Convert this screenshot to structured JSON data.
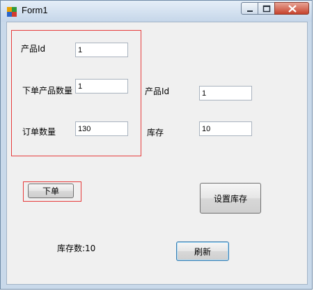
{
  "window": {
    "title": "Form1"
  },
  "order_group": {
    "product_id_label": "产品Id",
    "product_id_value": "1",
    "order_product_qty_label": "下单产品数量",
    "order_product_qty_value": "1",
    "order_qty_label": "订单数量",
    "order_qty_value": "130"
  },
  "stock_group": {
    "product_id_label": "产品Id",
    "product_id_value": "1",
    "stock_label": "库存",
    "stock_value": "10"
  },
  "buttons": {
    "place_order": "下单",
    "set_stock": "设置库存",
    "refresh": "刷新"
  },
  "status": {
    "stock_count_text": "库存数:10"
  },
  "colors": {
    "highlight_box": "#e63b3b",
    "client_bg": "#f0f0f0"
  }
}
